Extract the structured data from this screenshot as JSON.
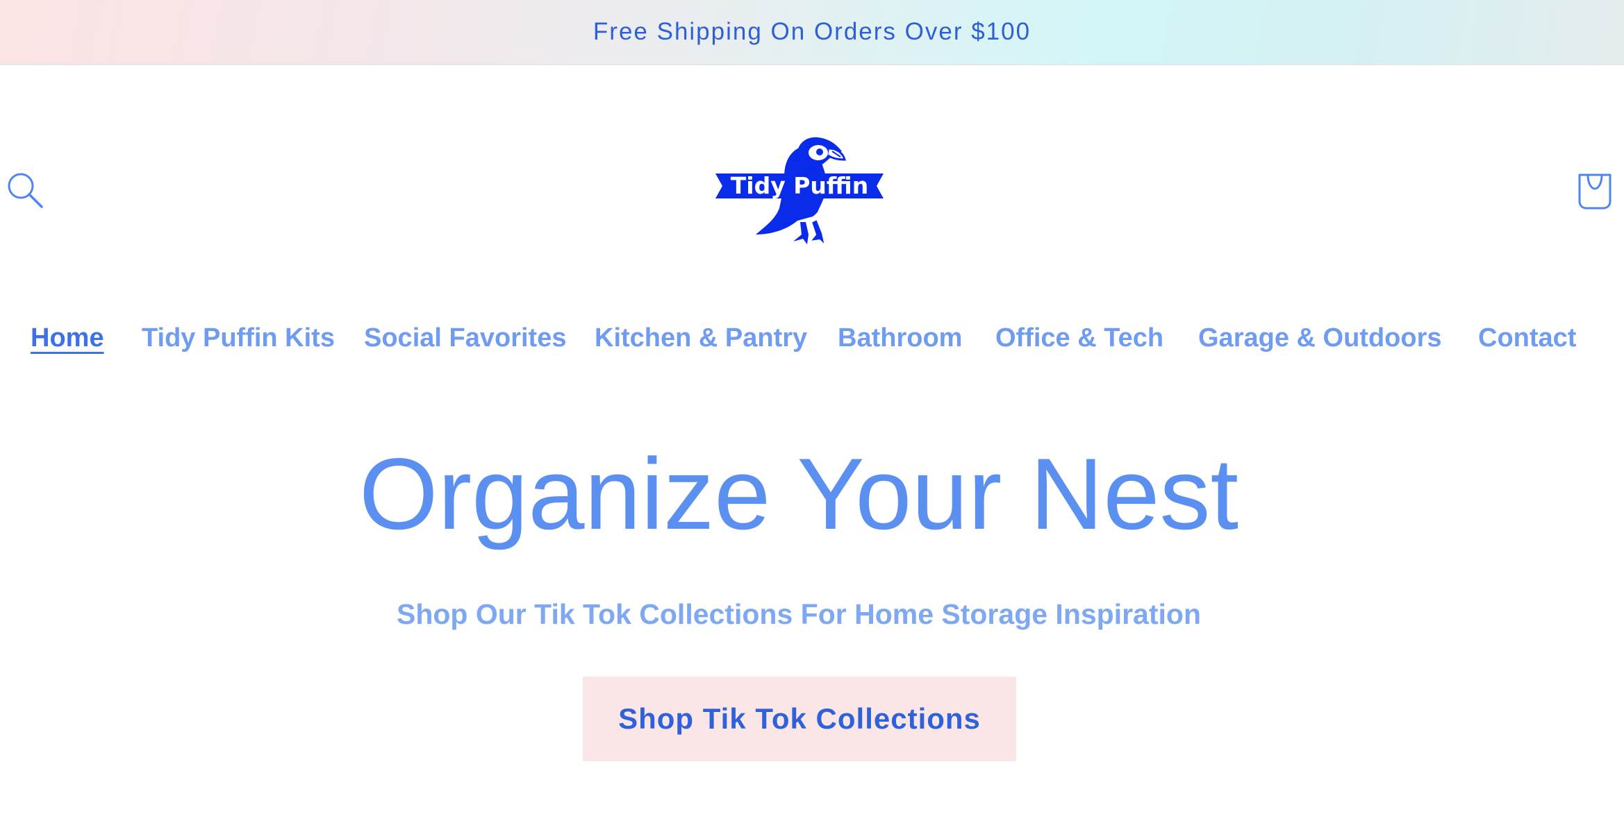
{
  "announcement": {
    "text": "Free Shipping On Orders Over $100"
  },
  "header": {
    "logo_text": "Tidy Puffin",
    "search_icon": "search-icon",
    "cart_icon": "cart-bag-icon"
  },
  "nav": {
    "items": [
      {
        "label": "Home",
        "active": true
      },
      {
        "label": "Tidy Puffin Kits",
        "active": false
      },
      {
        "label": "Social Favorites",
        "active": false
      },
      {
        "label": "Kitchen & Pantry",
        "active": false
      },
      {
        "label": "Bathroom",
        "active": false
      },
      {
        "label": "Office & Tech",
        "active": false
      },
      {
        "label": "Garage & Outdoors",
        "active": false
      },
      {
        "label": "Contact",
        "active": false
      }
    ]
  },
  "hero": {
    "title": "Organize Your Nest",
    "subtitle": "Shop Our Tik Tok Collections For Home Storage Inspiration",
    "button_label": "Shop Tik Tok Collections"
  },
  "colors": {
    "brand_blue": "#0b2bea",
    "nav_link": "#6f9cf0",
    "nav_active": "#3d72e6",
    "hero_title": "#5b8ff0",
    "button_bg": "#fae6e6",
    "button_text": "#2f62da"
  }
}
